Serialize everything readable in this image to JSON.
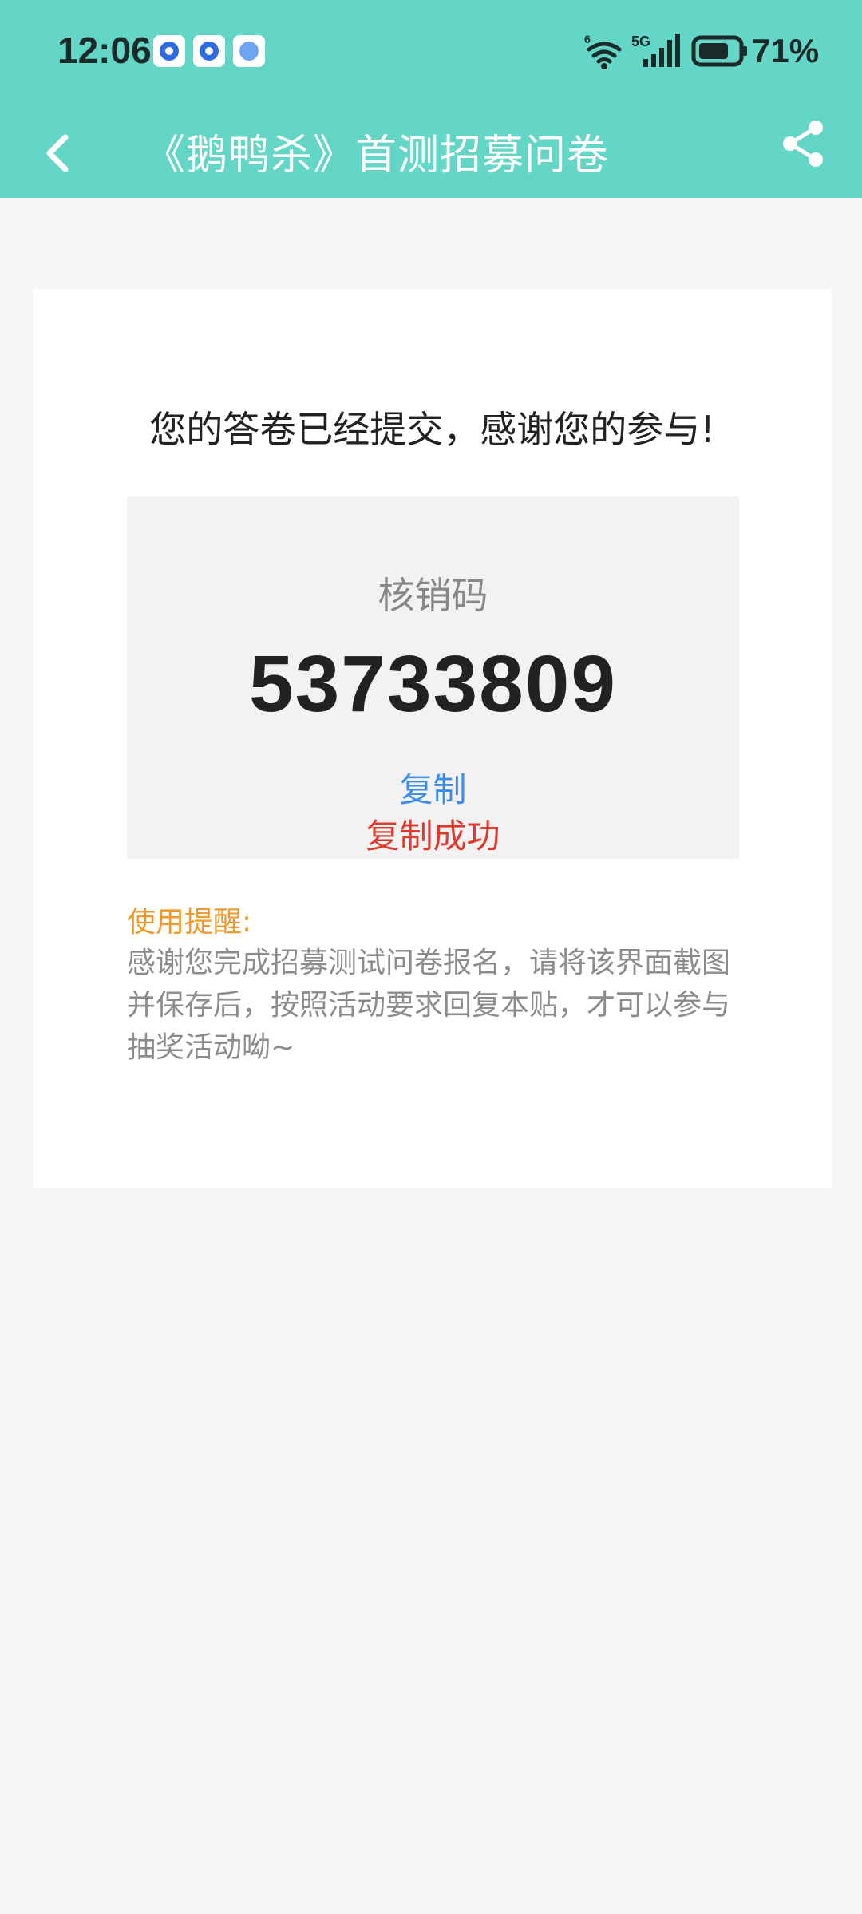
{
  "status_bar": {
    "time": "12:06",
    "battery_percent": "71%",
    "network": "5G",
    "icons": [
      "app-icon-a",
      "app-icon-b",
      "planet-app-icon",
      "wifi-icon",
      "signal-icon",
      "battery-icon"
    ]
  },
  "nav": {
    "title": "《鹅鸭杀》首测招募问卷",
    "back_icon": "back-arrow-icon",
    "share_icon": "share-icon"
  },
  "result": {
    "thanks": "您的答卷已经提交，感谢您的参与!",
    "code_label": "核销码",
    "code_value": "53733809",
    "copy_label": "复制",
    "copy_success": "复制成功"
  },
  "tips": {
    "title": "使用提醒:",
    "text": "感谢您完成招募测试问卷报名，请将该界面截图并保存后，按照活动要求回复本贴，才可以参与抽奖活动呦~"
  },
  "colors": {
    "header": "#64d6c6",
    "page_background": "#f6f6f6",
    "copy_link": "#3c8ee6",
    "success": "#e03a2e",
    "tips_title": "#ef9a2f"
  }
}
